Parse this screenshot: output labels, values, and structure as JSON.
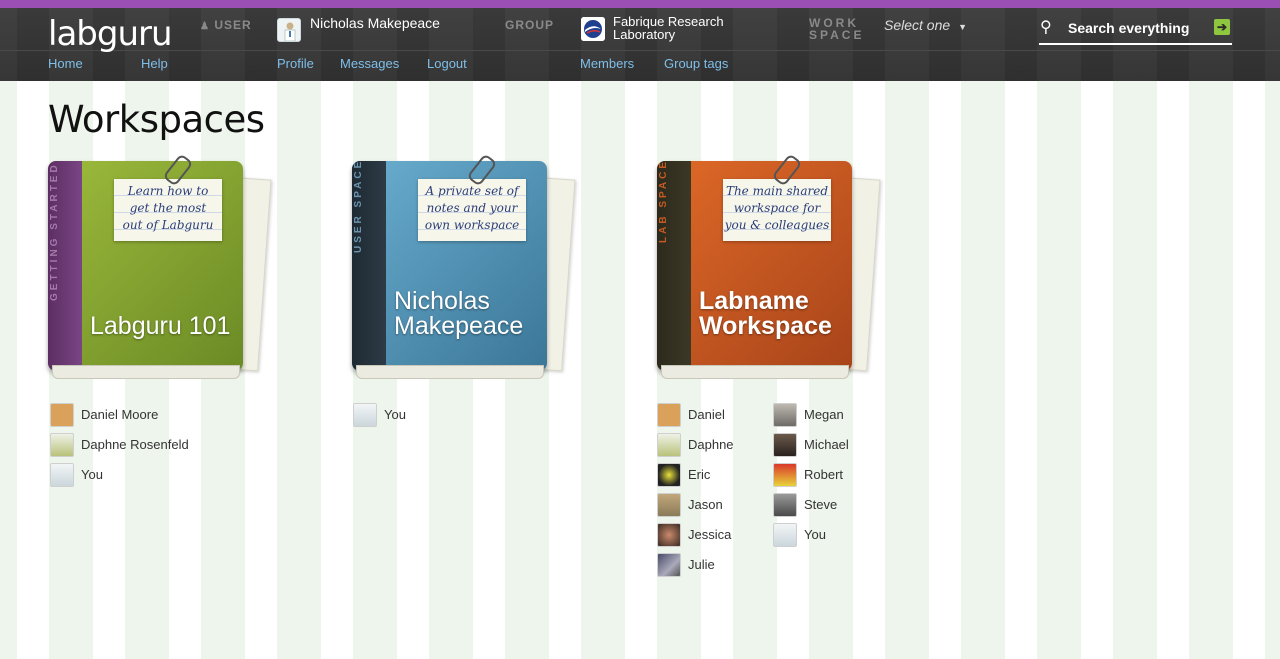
{
  "header": {
    "logo": "labguru",
    "user_label": "USER",
    "user_name": "Nicholas Makepeace",
    "group_label": "GROUP",
    "group_name_line1": "Fabrique Research",
    "group_name_line2": "Laboratory",
    "workspace_label_line1": "WORK",
    "workspace_label_line2": "SPACE",
    "workspace_select": "Select one",
    "search_placeholder": "Search everything",
    "nav": {
      "home": "Home",
      "help": "Help",
      "profile": "Profile",
      "messages": "Messages",
      "logout": "Logout",
      "members": "Members",
      "group_tags": "Group tags"
    }
  },
  "page_title": "Workspaces",
  "workspaces": [
    {
      "spine": "GETTING STARTED",
      "note": [
        "Learn how to",
        "get the most",
        "out of Labguru"
      ],
      "title_line1": "Labguru 101",
      "title_line2": "",
      "members": [
        "Daniel Moore",
        "Daphne Rosenfeld",
        "You"
      ]
    },
    {
      "spine": "USER SPACE",
      "note": [
        "A private set of",
        "notes and your",
        "own workspace"
      ],
      "title_line1": "Nicholas",
      "title_line2": "Makepeace",
      "members": [
        "You"
      ]
    },
    {
      "spine": "LAB SPACE",
      "note": [
        "The main shared",
        "workspace for",
        "you & colleagues"
      ],
      "title_line1": "Labname",
      "title_line2": "Workspace",
      "members_col1": [
        "Daniel",
        "Daphne",
        "Eric",
        "Jason",
        "Jessica",
        "Julie"
      ],
      "members_col2": [
        "Megan",
        "Michael",
        "Robert",
        "Steve",
        "You"
      ]
    }
  ],
  "colors": {
    "accent_purple": "#9b4fb4",
    "nav_link": "#7fbfe9",
    "book_green": "#7c9b2e",
    "book_blue": "#4d8fb0",
    "book_orange": "#c4561d"
  }
}
